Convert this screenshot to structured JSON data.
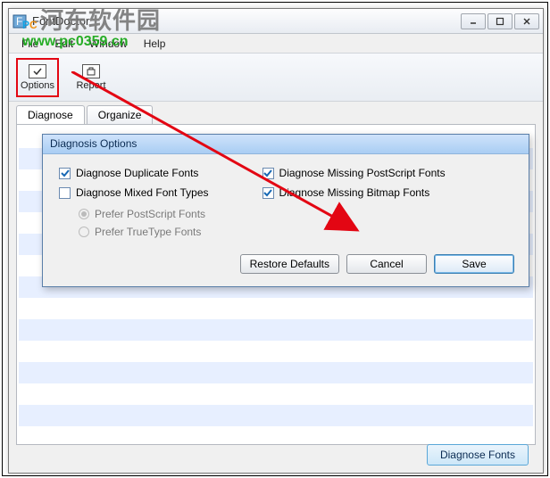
{
  "window": {
    "title": "FontDoctor"
  },
  "menu": {
    "file": "File",
    "edit": "Edit",
    "window": "Window",
    "help": "Help"
  },
  "toolbar": {
    "options": "Options",
    "report": "Report"
  },
  "tabs": {
    "diagnose": "Diagnose",
    "organize": "Organize"
  },
  "dialog": {
    "title": "Diagnosis Options",
    "opts": {
      "dup": "Diagnose Duplicate Fonts",
      "mixed": "Diagnose Mixed Font Types",
      "radio_ps": "Prefer PostScript Fonts",
      "radio_tt": "Prefer TrueType Fonts",
      "miss_ps": "Diagnose Missing PostScript Fonts",
      "miss_bmp": "Diagnose Missing Bitmap Fonts"
    },
    "buttons": {
      "restore": "Restore Defaults",
      "cancel": "Cancel",
      "save": "Save"
    }
  },
  "footer": {
    "diagnose_fonts": "Diagnose Fonts"
  },
  "watermark": {
    "brand": "河东软件园",
    "url": "www.pc0359.cn"
  }
}
